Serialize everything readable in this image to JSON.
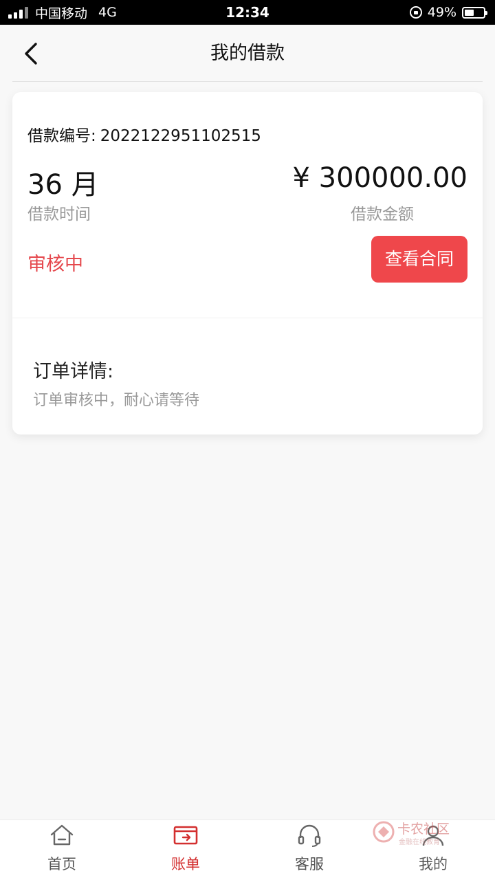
{
  "status_bar": {
    "carrier": "中国移动",
    "network": "4G",
    "time": "12:34",
    "battery": "49%",
    "battery_level": 0.49
  },
  "header": {
    "title": "我的借款",
    "back_icon": "chevron-left-icon"
  },
  "loan": {
    "number_label": "借款编号:",
    "number_value": "2022122951102515",
    "term_value": "36 月",
    "term_label": "借款时间",
    "amount_value": "¥ 300000.00",
    "amount_label": "借款金额",
    "status": "审核中",
    "contract_button": "查看合同",
    "detail_title": "订单详情:",
    "detail_text": "订单审核中，耐心请等待"
  },
  "bottom_nav": {
    "items": [
      {
        "label": "首页",
        "icon": "home-icon",
        "active": false
      },
      {
        "label": "账单",
        "icon": "bill-icon",
        "active": true
      },
      {
        "label": "客服",
        "icon": "headset-icon",
        "active": false
      },
      {
        "label": "我的",
        "icon": "user-icon",
        "active": false
      }
    ]
  },
  "watermark": {
    "title": "卡农社区",
    "subtitle": "金融在线教育"
  },
  "colors": {
    "accent": "#ef474b",
    "status_red": "#e5484d",
    "nav_active": "#d32f2f",
    "background": "#f8f8f8"
  }
}
